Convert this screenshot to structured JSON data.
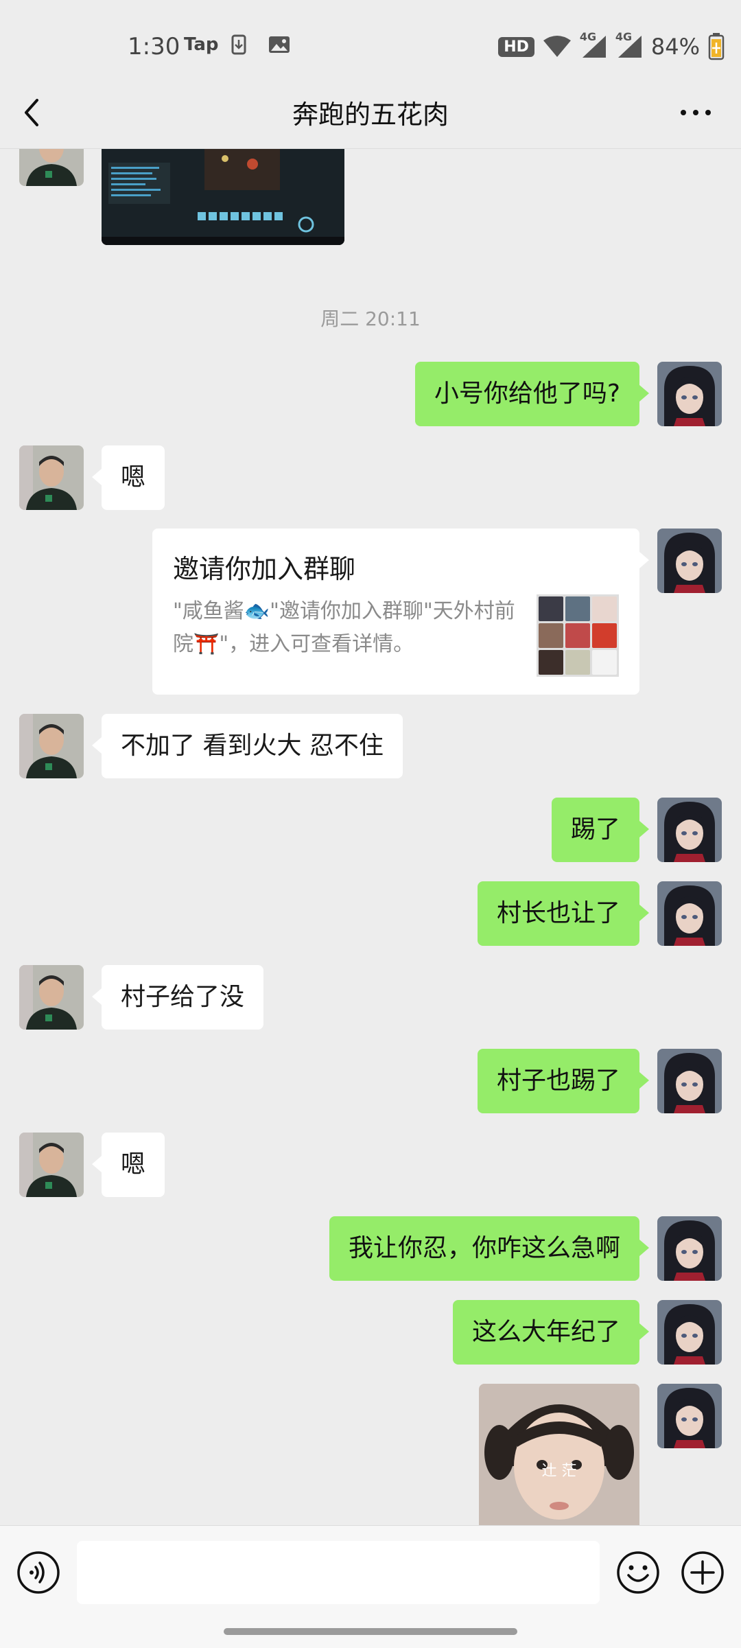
{
  "status_bar": {
    "time": "1:30",
    "tap_label": "Tap",
    "hd_label": "HD",
    "network_1": "4G",
    "network_2": "4G",
    "battery": "84%"
  },
  "header": {
    "title": "奔跑的五花肉",
    "back_icon": "chevron-left-icon",
    "more_icon": "more-horizontal-icon"
  },
  "chat": {
    "timestamp": "周二 20:11",
    "messages": [
      {
        "side": "right",
        "text": "小号你给他了吗?"
      },
      {
        "side": "left",
        "text": "嗯"
      },
      {
        "side": "right",
        "type": "invite"
      },
      {
        "side": "left",
        "text": "不加了 看到火大 忍不住"
      },
      {
        "side": "right",
        "text": "踢了"
      },
      {
        "side": "right",
        "text": "村长也让了"
      },
      {
        "side": "left",
        "text": "村子给了没"
      },
      {
        "side": "right",
        "text": "村子也踢了"
      },
      {
        "side": "left",
        "text": "嗯"
      },
      {
        "side": "right",
        "text": "我让你忍，你咋这么急啊"
      },
      {
        "side": "right",
        "text": "这么大年纪了"
      }
    ],
    "invite": {
      "title": "邀请你加入群聊",
      "description": "\"咸鱼酱🐟\"邀请你加入群聊\"天外村前院⛩️\"，进入可查看详情。"
    },
    "sticker_text": "辻  茫"
  },
  "input_bar": {
    "voice_icon": "voice-icon",
    "emoji_icon": "emoji-icon",
    "plus_icon": "plus-icon",
    "input_value": ""
  },
  "colors": {
    "background": "#ededed",
    "bubble_self": "#95ec69",
    "bubble_other": "#ffffff"
  }
}
